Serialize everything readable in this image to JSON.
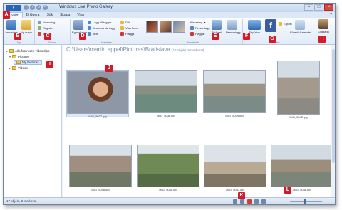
{
  "app": {
    "title": "Windows Live Photo Gallery",
    "file_tab": "▾",
    "tabs": [
      "Start",
      "Bridgera",
      "Sök",
      "Skapa",
      "Visa"
    ],
    "help": "?"
  },
  "ribbon": {
    "groups": [
      "Ny",
      "Ordna",
      "Hantera",
      "Snabbsök",
      "Dela"
    ],
    "buttons": {
      "import": "Importera",
      "new_folder": "Ny mapp",
      "name_tag": "Namn tag",
      "register": "Register",
      "delete": "Ta bort",
      "properties": "Egenskaper",
      "tags": "Lägg till taggar",
      "describe": "Beskrivande tagg",
      "text": "Text",
      "hide": "Dölj",
      "show_all": "Visa flera",
      "flag": "Flagga",
      "rating": "Klassning",
      "flagged": "Flaggat",
      "people_tag": "Persontagg",
      "slideshow": "Bildspel",
      "skydrive": "SkyDrive",
      "facebook": "f",
      "email": "E-post",
      "prev_next": "Föreslå/kalender",
      "sign_in": "Logga in"
    }
  },
  "nav": {
    "items": [
      {
        "label": "Alla foton och videoklipp"
      },
      {
        "label": "Pictures"
      },
      {
        "label": "My Pictures"
      },
      {
        "label": "Videos"
      }
    ]
  },
  "content": {
    "path": "C:\\Users\\martin.appel\\Pictures\\Bratislava",
    "count": "(17 objekt, 8 markerat)",
    "photos": [
      {
        "caption": "IMG_5037.jpg"
      },
      {
        "caption": "IMG_5038.jpg"
      },
      {
        "caption": "IMG_5039.jpg"
      },
      {
        "caption": "IMG_5042.jpg"
      },
      {
        "caption": "IMG_5046.jpg"
      },
      {
        "caption": "IMG_5045.jpg"
      },
      {
        "caption": "IMG_5047.jpg"
      },
      {
        "caption": "IMG_5048.jpg"
      }
    ]
  },
  "status": {
    "text": "17 objekt, 8 markerat"
  },
  "markers": [
    "A",
    "B",
    "C",
    "D",
    "E",
    "F",
    "G",
    "H",
    "I",
    "J",
    "K",
    "L"
  ],
  "colors": {
    "marker": "#d21b26",
    "accent": "#2a64b8"
  },
  "icons": {
    "back": "back-icon",
    "forward": "forward-icon",
    "rotate": "rotate-icon",
    "delete": "delete-icon",
    "zoom": "zoom-icon"
  }
}
